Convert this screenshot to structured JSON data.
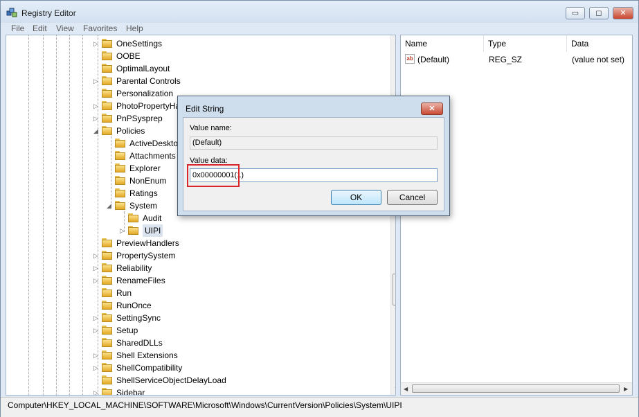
{
  "window": {
    "title": "Registry Editor"
  },
  "menu": [
    "File",
    "Edit",
    "View",
    "Favorites",
    "Help"
  ],
  "tree": {
    "items": [
      {
        "label": "OneSettings",
        "expander": "▷"
      },
      {
        "label": "OOBE",
        "expander": ""
      },
      {
        "label": "OptimalLayout",
        "expander": ""
      },
      {
        "label": "Parental Controls",
        "expander": "▷"
      },
      {
        "label": "Personalization",
        "expander": ""
      },
      {
        "label": "PhotoPropertyHandler",
        "expander": "▷"
      },
      {
        "label": "PnPSysprep",
        "expander": "▷"
      },
      {
        "label": "Policies",
        "expander": "◢"
      },
      {
        "label": "ActiveDesktop",
        "expander": ""
      },
      {
        "label": "Attachments",
        "expander": ""
      },
      {
        "label": "Explorer",
        "expander": ""
      },
      {
        "label": "NonEnum",
        "expander": ""
      },
      {
        "label": "Ratings",
        "expander": ""
      },
      {
        "label": "System",
        "expander": "◢"
      },
      {
        "label": "Audit",
        "expander": ""
      },
      {
        "label": "UIPI",
        "expander": "▷"
      },
      {
        "label": "PreviewHandlers",
        "expander": ""
      },
      {
        "label": "PropertySystem",
        "expander": "▷"
      },
      {
        "label": "Reliability",
        "expander": "▷"
      },
      {
        "label": "RenameFiles",
        "expander": "▷"
      },
      {
        "label": "Run",
        "expander": ""
      },
      {
        "label": "RunOnce",
        "expander": ""
      },
      {
        "label": "SettingSync",
        "expander": "▷"
      },
      {
        "label": "Setup",
        "expander": "▷"
      },
      {
        "label": "SharedDLLs",
        "expander": ""
      },
      {
        "label": "Shell Extensions",
        "expander": "▷"
      },
      {
        "label": "ShellCompatibility",
        "expander": "▷"
      },
      {
        "label": "ShellServiceObjectDelayLoad",
        "expander": ""
      },
      {
        "label": "Sidebar",
        "expander": "▷"
      }
    ],
    "selected": "UIPI"
  },
  "list": {
    "columns": [
      "Name",
      "Type",
      "Data"
    ],
    "rows": [
      {
        "name": "(Default)",
        "type": "REG_SZ",
        "data": "(value not set)",
        "icon": "ab-string-icon"
      }
    ]
  },
  "dialog": {
    "title": "Edit String",
    "close_glyph": "✕",
    "value_name_label": "Value name:",
    "value_name": "(Default)",
    "value_data_label": "Value data:",
    "value_data": "0x00000001(1)",
    "ok_label": "OK",
    "cancel_label": "Cancel",
    "highlight_color": "#d9262c"
  },
  "status": {
    "path": "Computer\\HKEY_LOCAL_MACHINE\\SOFTWARE\\Microsoft\\Windows\\CurrentVersion\\Policies\\System\\UIPI"
  },
  "icons": {
    "minimize": "▭",
    "maximize": "◻",
    "close": "✕",
    "up_arrow": "▲",
    "down_arrow": "▼",
    "left_arrow": "◀",
    "right_arrow": "▶"
  }
}
